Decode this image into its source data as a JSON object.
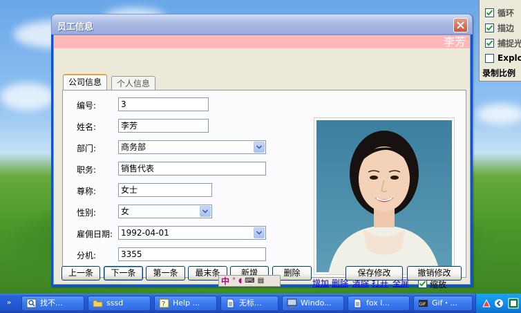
{
  "window": {
    "title": "员工信息",
    "banner_name": "李芳"
  },
  "tabs": [
    {
      "label": "公司信息",
      "active": true
    },
    {
      "label": "个人信息",
      "active": false
    }
  ],
  "form": {
    "id_label": "编号:",
    "id_value": "3",
    "name_label": "姓名:",
    "name_value": "李芳",
    "dept_label": "部门:",
    "dept_value": "商务部",
    "title_label": "职务:",
    "title_value": "销售代表",
    "courtesy_label": "尊称:",
    "courtesy_value": "女士",
    "gender_label": "性别:",
    "gender_value": "女",
    "hire_label": "雇佣日期:",
    "hire_value": "1992-04-01",
    "ext_label": "分机:",
    "ext_value": "3355"
  },
  "photo_actions": {
    "add": "增加",
    "delete": "删除",
    "clear": "清除",
    "open": "打开",
    "fullscreen": "全屏",
    "zoom_label": "缩放",
    "zoom_checked": true
  },
  "buttons": {
    "prev": "上一条",
    "next": "下一条",
    "first": "第一条",
    "last": "最末条",
    "new": "新增",
    "delete": "删除",
    "save": "保存修改",
    "undo": "撤销修改"
  },
  "side_panel": {
    "items": [
      {
        "label": "循环",
        "checked": true
      },
      {
        "label": "描边",
        "checked": true
      },
      {
        "label": "捕捉光",
        "checked": true
      },
      {
        "label": "Explo",
        "checked": false
      }
    ],
    "footer": "录制比例"
  },
  "taskbar": {
    "items": [
      {
        "label": "找不...",
        "icon": "search-icon"
      },
      {
        "label": "sssd",
        "icon": "folder-icon"
      },
      {
        "label": "Help ...",
        "icon": "help-icon"
      },
      {
        "label": "无标...",
        "icon": "document-icon"
      },
      {
        "label": "Windo...",
        "icon": "computer-icon"
      },
      {
        "label": "fox l...",
        "icon": "document-icon"
      },
      {
        "label": "Gif・...",
        "icon": "gif-icon"
      }
    ]
  },
  "ime": {
    "mode": "中"
  },
  "colors": {
    "titlebar": "#a6b7e3",
    "banner": "#ffb7ba",
    "dialog_bg": "#ece9d8",
    "taskbar": "#225ad4",
    "link": "#0000cc"
  }
}
